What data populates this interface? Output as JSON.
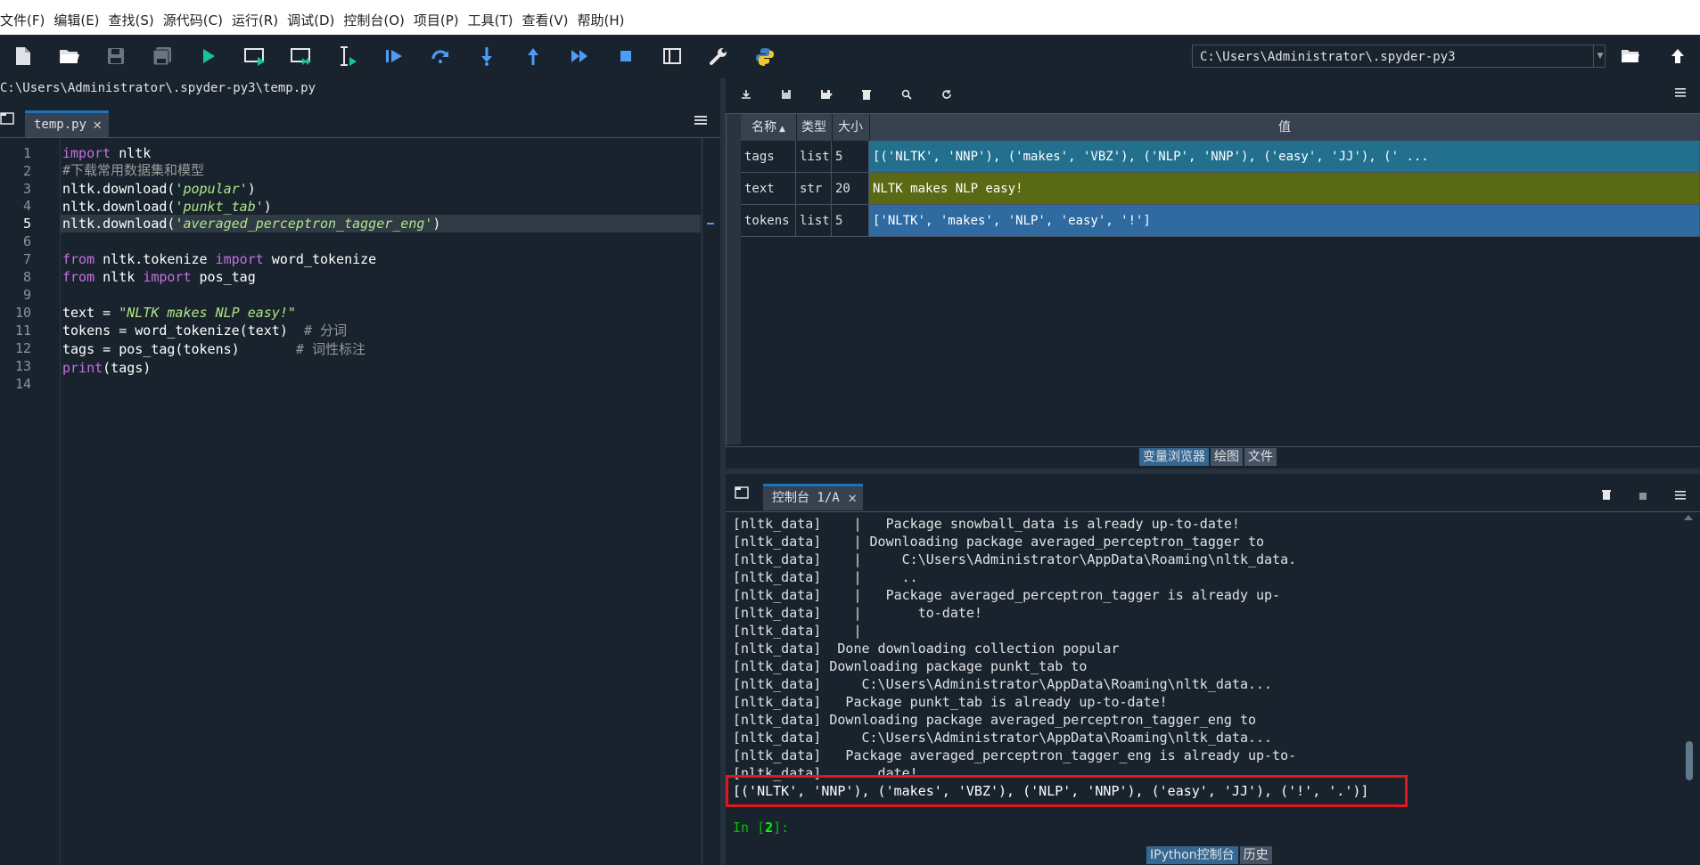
{
  "menu": [
    "文件(F)",
    "编辑(E)",
    "查找(S)",
    "源代码(C)",
    "运行(R)",
    "调试(D)",
    "控制台(O)",
    "项目(P)",
    "工具(T)",
    "查看(V)",
    "帮助(H)"
  ],
  "toolbar": {
    "icons": [
      "new-file-icon",
      "open-file-icon",
      "save-icon",
      "save-all-icon",
      "run-icon",
      "run-cell-icon",
      "run-cell-advance-icon",
      "run-selection-icon",
      "debug-icon",
      "step-over-icon",
      "step-into-icon",
      "step-out-icon",
      "continue-icon",
      "stop-icon",
      "maximize-pane-icon",
      "preferences-wrench-icon",
      "python-path-icon"
    ],
    "working_dir": "C:\\Users\\Administrator\\.spyder-py3"
  },
  "editor": {
    "file_path": "C:\\Users\\Administrator\\.spyder-py3\\temp.py",
    "tab_label": "temp.py",
    "current_line": 5,
    "lines": [
      {
        "n": "1",
        "code": "import nltk"
      },
      {
        "n": "2",
        "code": "#下载常用数据集和模型"
      },
      {
        "n": "3",
        "code": "nltk.download('popular')"
      },
      {
        "n": "4",
        "code": "nltk.download('punkt_tab')"
      },
      {
        "n": "5",
        "code": "nltk.download('averaged_perceptron_tagger_eng')"
      },
      {
        "n": "6",
        "code": ""
      },
      {
        "n": "7",
        "code": "from nltk.tokenize import word_tokenize"
      },
      {
        "n": "8",
        "code": "from nltk import pos_tag"
      },
      {
        "n": "9",
        "code": ""
      },
      {
        "n": "10",
        "code": "text = \"NLTK makes NLP easy!\""
      },
      {
        "n": "11",
        "code": "tokens = word_tokenize(text)  # 分词"
      },
      {
        "n": "12",
        "code": "tags = pos_tag(tokens)       # 词性标注"
      },
      {
        "n": "13",
        "code": "print(tags)"
      },
      {
        "n": "14",
        "code": ""
      }
    ],
    "tokens": {
      "l1": {
        "kw": "import",
        "rest": " nltk"
      },
      "l2": {
        "cm": "#下载常用数据集和模型"
      },
      "l3": {
        "pre": "nltk.download(",
        "str": "'popular'",
        "post": ")"
      },
      "l4": {
        "pre": "nltk.download(",
        "str": "'punkt_tab'",
        "post": ")"
      },
      "l5": {
        "pre": "nltk.download(",
        "str": "'averaged_perceptron_tagger_eng'",
        "post": ")"
      },
      "l7": {
        "kw1": "from",
        "mid": " nltk.tokenize ",
        "kw2": "import",
        "rest": " word_tokenize"
      },
      "l8": {
        "kw1": "from",
        "mid": " nltk ",
        "kw2": "import",
        "rest": " pos_tag"
      },
      "l10": {
        "pre": "text = ",
        "str": "\"NLTK makes NLP easy!\""
      },
      "l11": {
        "pre": "tokens = word_tokenize(text)  ",
        "cm": "# 分词"
      },
      "l12": {
        "pre": "tags = pos_tag(tokens)       ",
        "cm": "# 词性标注"
      },
      "l13": {
        "kw": "print",
        "rest": "(tags)"
      }
    }
  },
  "variable_explorer": {
    "toolbar_icons": [
      "import-data-icon",
      "save-data-icon",
      "save-data-as-icon",
      "remove-all-icon",
      "search-icon",
      "refresh-icon"
    ],
    "columns": {
      "name": "名称",
      "type": "类型",
      "size": "大小",
      "value": "值"
    },
    "rows": [
      {
        "name": "tags",
        "type": "list",
        "size": "5",
        "value": "[('NLTK', 'NNP'), ('makes', 'VBZ'), ('NLP', 'NNP'), ('easy', 'JJ'), (' ...",
        "color": "#236f8e"
      },
      {
        "name": "text",
        "type": "str",
        "size": "20",
        "value": "NLTK makes NLP easy!",
        "color": "#5a6a14"
      },
      {
        "name": "tokens",
        "type": "list",
        "size": "5",
        "value": "['NLTK', 'makes', 'NLP', 'easy', '!']",
        "color": "#2f6aa1"
      }
    ],
    "tabs": [
      "变量浏览器",
      "绘图",
      "文件"
    ]
  },
  "console": {
    "tab_label": "控制台 1/A",
    "lines": [
      "[nltk_data]    |   Package snowball_data is already up-to-date!",
      "[nltk_data]    | Downloading package averaged_perceptron_tagger to",
      "[nltk_data]    |     C:\\Users\\Administrator\\AppData\\Roaming\\nltk_data.",
      "[nltk_data]    |     ..",
      "[nltk_data]    |   Package averaged_perceptron_tagger is already up-",
      "[nltk_data]    |       to-date!",
      "[nltk_data]    |",
      "[nltk_data]  Done downloading collection popular",
      "[nltk_data] Downloading package punkt_tab to",
      "[nltk_data]     C:\\Users\\Administrator\\AppData\\Roaming\\nltk_data...",
      "[nltk_data]   Package punkt_tab is already up-to-date!",
      "[nltk_data] Downloading package averaged_perceptron_tagger_eng to",
      "[nltk_data]     C:\\Users\\Administrator\\AppData\\Roaming\\nltk_data...",
      "[nltk_data]   Package averaged_perceptron_tagger_eng is already up-to-",
      "[nltk_data]       date!"
    ],
    "result": "[('NLTK', 'NNP'), ('makes', 'VBZ'), ('NLP', 'NNP'), ('easy', 'JJ'), ('!', '.')]",
    "prompt_prefix": "In [",
    "prompt_number": "2",
    "prompt_suffix": "]:",
    "tabs": [
      "IPython控制台",
      "历史"
    ]
  },
  "colors": {
    "background": "#19232d",
    "accent": "#1a72bb",
    "highlight_box": "#e0171d",
    "prompt": "#00c000"
  }
}
